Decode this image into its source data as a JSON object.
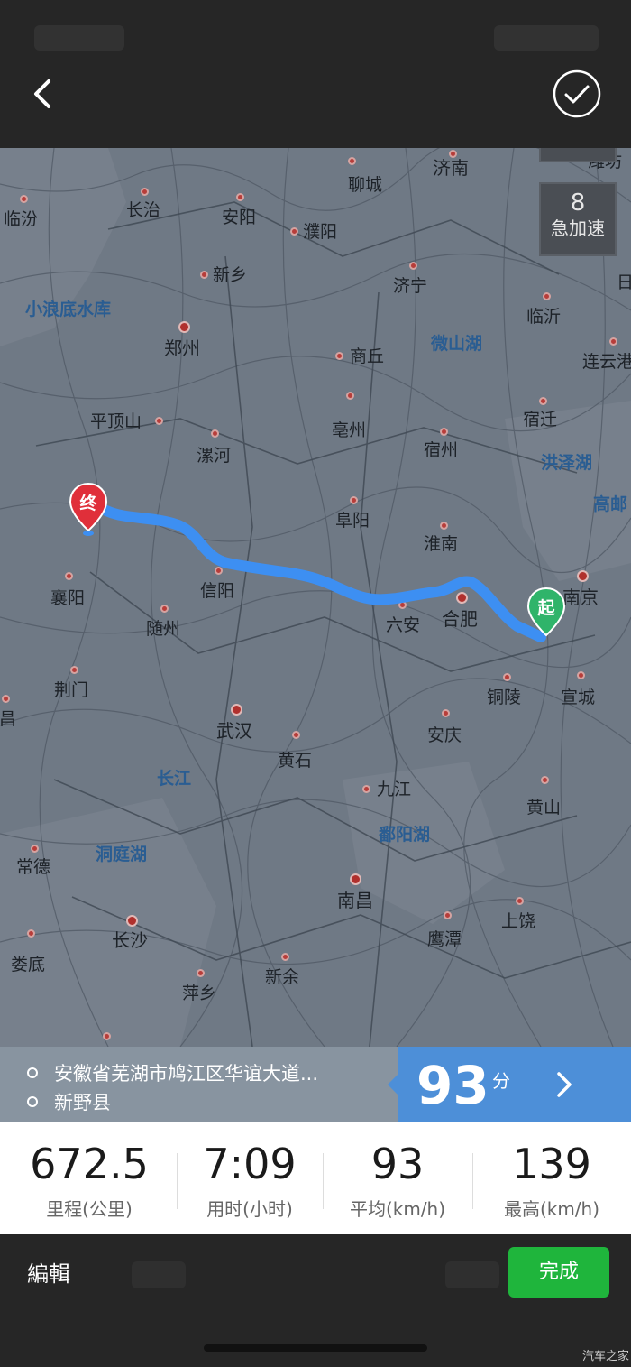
{
  "header": {
    "back_icon": "chevron-left-icon",
    "confirm_icon": "check-circle-icon"
  },
  "map": {
    "cities": [
      {
        "name": "济南",
        "cap": true
      },
      {
        "name": "潍坊",
        "cap": false
      },
      {
        "name": "聊城",
        "cap": false
      },
      {
        "name": "临汾",
        "cap": false
      },
      {
        "name": "长治",
        "cap": false
      },
      {
        "name": "安阳",
        "cap": false
      },
      {
        "name": "濮阳",
        "cap": false
      },
      {
        "name": "新乡",
        "cap": false
      },
      {
        "name": "济宁",
        "cap": false
      },
      {
        "name": "临沂",
        "cap": false
      },
      {
        "name": "日",
        "cap": false
      },
      {
        "name": "郑州",
        "cap": true
      },
      {
        "name": "商丘",
        "cap": false
      },
      {
        "name": "连云港",
        "cap": false
      },
      {
        "name": "平顶山",
        "cap": false
      },
      {
        "name": "亳州",
        "cap": false
      },
      {
        "name": "宿迁",
        "cap": false
      },
      {
        "name": "漯河",
        "cap": false
      },
      {
        "name": "宿州",
        "cap": false
      },
      {
        "name": "阜阳",
        "cap": false
      },
      {
        "name": "淮南",
        "cap": false
      },
      {
        "name": "南京",
        "cap": true
      },
      {
        "name": "襄阳",
        "cap": false
      },
      {
        "name": "信阳",
        "cap": false
      },
      {
        "name": "六安",
        "cap": false
      },
      {
        "name": "合肥",
        "cap": true
      },
      {
        "name": "随州",
        "cap": false
      },
      {
        "name": "荆门",
        "cap": false
      },
      {
        "name": "铜陵",
        "cap": false
      },
      {
        "name": "宣城",
        "cap": false
      },
      {
        "name": "宜昌",
        "cap": false
      },
      {
        "name": "武汉",
        "cap": true
      },
      {
        "name": "安庆",
        "cap": false
      },
      {
        "name": "黄石",
        "cap": false
      },
      {
        "name": "九江",
        "cap": false
      },
      {
        "name": "黄山",
        "cap": false
      },
      {
        "name": "常德",
        "cap": false
      },
      {
        "name": "南昌",
        "cap": true
      },
      {
        "name": "长沙",
        "cap": true
      },
      {
        "name": "鹰潭",
        "cap": false
      },
      {
        "name": "上饶",
        "cap": false
      },
      {
        "name": "娄底",
        "cap": false
      },
      {
        "name": "新余",
        "cap": false
      },
      {
        "name": "萍乡",
        "cap": false
      }
    ],
    "water": [
      "小浪底水库",
      "微山湖",
      "洪泽湖",
      "高邮",
      "长江",
      "洞庭湖",
      "鄱阳湖"
    ],
    "counter": {
      "value": "8",
      "label": "急加速"
    },
    "end_marker": "终",
    "start_marker": "起",
    "route_color": "#3d8ff2"
  },
  "trip": {
    "from": "安徽省芜湖市鸠江区华谊大道...",
    "to": "新野县",
    "score": "93",
    "score_unit": "分"
  },
  "stats": [
    {
      "value": "672.5",
      "label": "里程(公里)"
    },
    {
      "value": "7:09",
      "label": "用时(小时)"
    },
    {
      "value": "93",
      "label": "平均(km/h)"
    },
    {
      "value": "139",
      "label": "最高(km/h)"
    }
  ],
  "footer": {
    "edit_label": "編輯",
    "done_label": "完成",
    "watermark": "汽车之家"
  }
}
